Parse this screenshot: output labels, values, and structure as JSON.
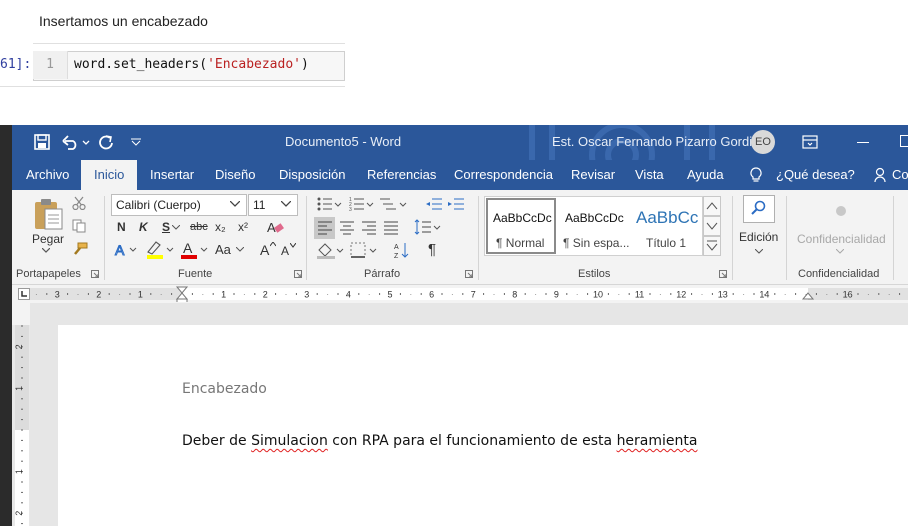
{
  "notebook": {
    "markdown_text": "Insertamos un encabezado",
    "prompt": "61]:",
    "line_number": "1",
    "code_prefix": "word.set_headers(",
    "code_string": "'Encabezado'",
    "code_suffix": ")"
  },
  "word": {
    "title": "Documento5  -  Word",
    "user_name": "Est. Oscar Fernando Pizarro Gordillo",
    "user_initials": "EO",
    "tabs": [
      "Archivo",
      "Inicio",
      "Insertar",
      "Diseño",
      "Disposición",
      "Referencias",
      "Correspondencia",
      "Revisar",
      "Vista",
      "Ayuda"
    ],
    "tell_me": "¿Qué desea?",
    "share_partial": "Co",
    "ribbon": {
      "clipboard": {
        "paste_label": "Pegar",
        "group_label": "Portapapeles"
      },
      "font": {
        "font_name": "Calibri (Cuerpo)",
        "font_size": "11",
        "group_label": "Fuente",
        "bold": "N",
        "italic": "K",
        "underline": "S",
        "strike": "abc",
        "sub": "x₂",
        "sup": "x²",
        "grow": "A",
        "shrink": "A",
        "case": "Aa"
      },
      "paragraph": {
        "group_label": "Párrafo",
        "pilcrow": "¶"
      },
      "styles": {
        "group_label": "Estilos",
        "items": [
          {
            "preview": "AaBbCcDc",
            "name": "¶ Normal"
          },
          {
            "preview": "AaBbCcDc",
            "name": "¶ Sin espa..."
          },
          {
            "preview": "AaBbCc",
            "name": "Título 1"
          }
        ]
      },
      "editing": {
        "label": "Edición"
      },
      "sensitivity": {
        "label": "Confidencialidad",
        "group_label": "Confidencialidad"
      }
    },
    "ruler_numbers": [
      "3",
      "2",
      "1",
      "1",
      "2",
      "3",
      "4",
      "5",
      "6",
      "7",
      "8",
      "9",
      "10",
      "11",
      "12",
      "13",
      "14",
      "16"
    ],
    "vruler_numbers": [
      "2",
      "1",
      "1",
      "2"
    ],
    "document": {
      "header_text": "Encabezado",
      "body_pre": "Deber de ",
      "body_err1": "Simulacion",
      "body_mid": " con RPA para el funcionamiento de esta ",
      "body_err2": "heramienta"
    },
    "colors": {
      "accent": "#2b579a",
      "ribbon_bg": "#f3f3f3",
      "error_underline": "#e02020"
    }
  }
}
